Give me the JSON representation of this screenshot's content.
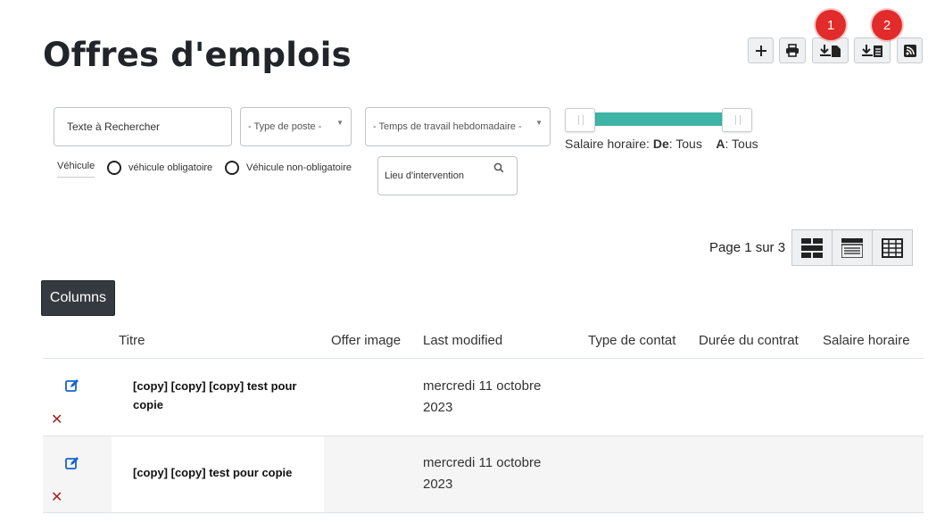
{
  "page": {
    "title": "Offres d'emplois"
  },
  "toolbar": {
    "add": "add-icon",
    "print": "print-icon",
    "download_doc": "download-document-icon",
    "download_list": "download-list-icon",
    "rss": "rss-icon",
    "markers": [
      "1",
      "2"
    ],
    "marker_color": "#e22b2b"
  },
  "filters": {
    "search_placeholder": "Texte à Rechercher",
    "type_poste": "- Type de poste -",
    "temps_travail": "- Temps de travail hebdomadaire -",
    "salaire_label": "Salaire horaire:",
    "salaire_de_label": "De",
    "salaire_de_value": ": Tous",
    "salaire_a_label": "A",
    "salaire_a_value": ": Tous",
    "slider_color": "#3db4a5",
    "vehicule_label": "Véhicule",
    "radio_obligatoire": "véhicule obligatoire",
    "radio_non_obligatoire": "Véhicule non-obligatoire",
    "lieu_placeholder": "Lieu d'intervention"
  },
  "pagination": {
    "text": "Page 1 sur 3"
  },
  "columns_button": "Columns",
  "table": {
    "headers": [
      "Titre",
      "Offer image",
      "Last modified",
      "Type de contat",
      "Durée du contrat",
      "Salaire horaire"
    ],
    "rows": [
      {
        "title_line1": "[copy] [copy] [copy] test pour",
        "title_line2": "copie",
        "date_line1": "mercredi 11 octobre",
        "date_line2": "2023"
      },
      {
        "title_line1": "[copy] [copy] test pour copie",
        "title_line2": "",
        "date_line1": "mercredi 11 octobre",
        "date_line2": "2023"
      }
    ]
  }
}
